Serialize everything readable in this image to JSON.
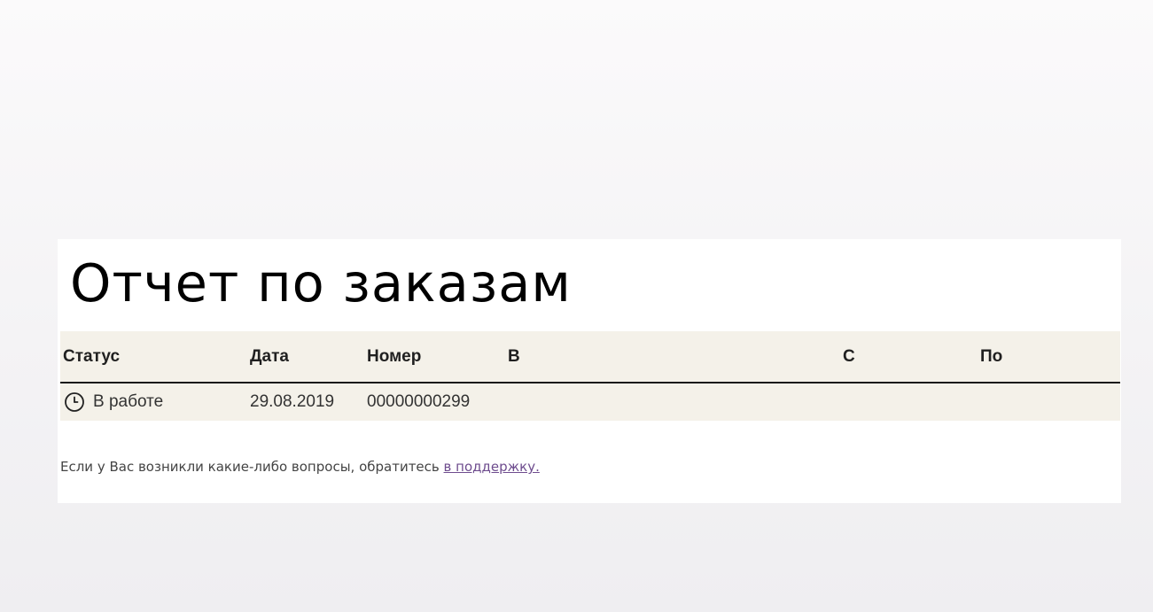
{
  "page": {
    "title": "Отчет по заказам"
  },
  "table": {
    "columns": [
      "Статус",
      "Дата",
      "Номер",
      "В",
      "С",
      "По"
    ],
    "rows": [
      {
        "status": "В работе",
        "status_icon": "clock-icon",
        "date": "29.08.2019",
        "number": "00000000299",
        "v": "",
        "s": "",
        "po": ""
      }
    ]
  },
  "footer": {
    "text": "Если у Вас возникли какие-либо вопросы, обратитесь ",
    "link_label": "в поддержку."
  },
  "colors": {
    "table_background": "#f4f1e9",
    "header_rule": "#1a1a1a",
    "link": "#6e4c8e"
  }
}
